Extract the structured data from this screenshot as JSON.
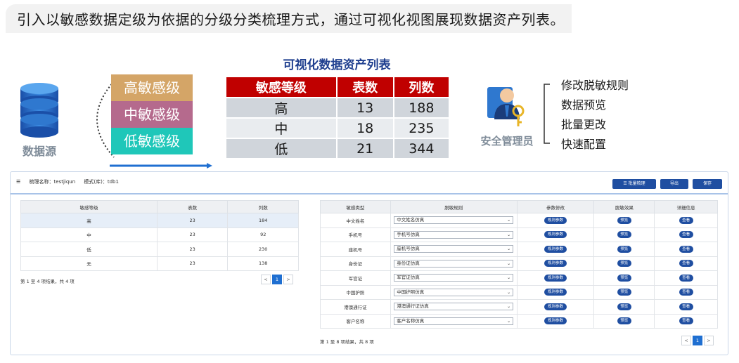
{
  "headline": "引入以敏感数据定级为依据的分级分类梳理方式，通过可视化视图展现数据资产列表。",
  "datasource": {
    "label": "数据源",
    "icon": "database-icon"
  },
  "levels": [
    {
      "label": "高敏感级",
      "color": "#d4a567"
    },
    {
      "label": "中敏感级",
      "color": "#b56a8d"
    },
    {
      "label": "低敏感级",
      "color": "#1fc7b9"
    }
  ],
  "viz_table": {
    "title": "可视化数据资产列表",
    "headers": [
      "敏感等级",
      "表数",
      "列数"
    ],
    "rows": [
      [
        "高",
        "13",
        "188"
      ],
      [
        "中",
        "18",
        "235"
      ],
      [
        "低",
        "21",
        "344"
      ]
    ]
  },
  "admin": {
    "label": "安全管理员",
    "icon": "admin-key-icon",
    "actions": [
      "修改脱敏规则",
      "数据预览",
      "批量更改",
      "快速配置"
    ]
  },
  "app": {
    "toolbar": {
      "name_label": "梳理名称：testjiqun",
      "mode_label": "模式(库)：tdb1",
      "buttons": [
        "批量梳理",
        "导出",
        "保存"
      ]
    },
    "left_table": {
      "headers": [
        "敏感等级",
        "表数",
        "列数"
      ],
      "rows": [
        [
          "高",
          "23",
          "184"
        ],
        [
          "中",
          "23",
          "92"
        ],
        [
          "低",
          "23",
          "230"
        ],
        [
          "无",
          "23",
          "138"
        ]
      ],
      "footer": "第 1 至 4 项结果，共 4 项",
      "page": "1"
    },
    "right_table": {
      "headers": [
        "敏感类型",
        "脱敏规则",
        "参数修改",
        "脱敏效果",
        "详细信息"
      ],
      "rows": [
        {
          "type": "中文姓名",
          "rule": "中文姓名仿真"
        },
        {
          "type": "手机号",
          "rule": "手机号仿真"
        },
        {
          "type": "座机号",
          "rule": "座机号仿真"
        },
        {
          "type": "身份证",
          "rule": "身份证仿真"
        },
        {
          "type": "军官证",
          "rule": "军官证仿真"
        },
        {
          "type": "中国护照",
          "rule": "中国护照仿真"
        },
        {
          "type": "港澳通行证",
          "rule": "港澳通行证仿真"
        },
        {
          "type": "客户名称",
          "rule": "客户名称仿真"
        }
      ],
      "param_label": "规则参数",
      "effect_label": "预览",
      "detail_label": "查看",
      "footer": "第 1 至 8 项结果，共 8 项",
      "page": "1"
    },
    "pager_prev": "<",
    "pager_next": ">"
  }
}
